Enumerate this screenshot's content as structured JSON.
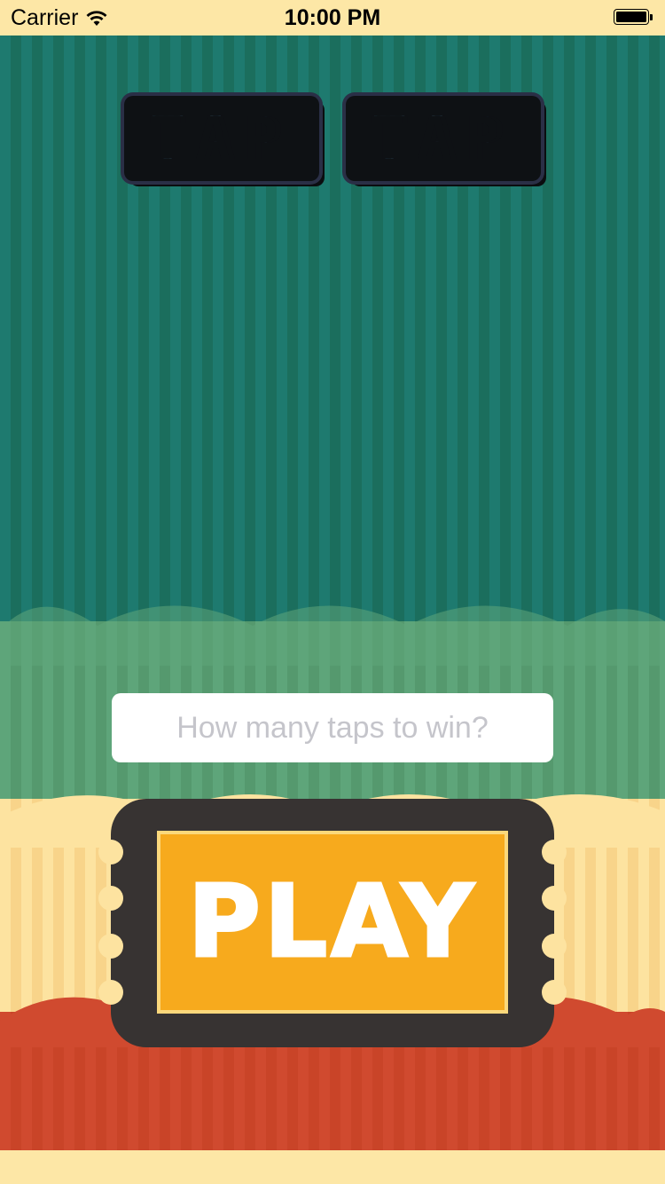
{
  "status_bar": {
    "carrier": "Carrier",
    "time": "10:00 PM",
    "wifi_icon": "wifi-icon",
    "battery_icon": "battery-icon",
    "battery_level": 1.0
  },
  "title": {
    "word1": "TAP",
    "word2": "TAP"
  },
  "taps_input": {
    "value": "",
    "placeholder": "How many taps to win?"
  },
  "play_button": {
    "label": "PLAY"
  },
  "colors": {
    "teal": "#1e7a6f",
    "green": "#5ea57a",
    "cream": "#fde3a0",
    "red": "#d04a2f",
    "ticket_dark": "#373332",
    "ticket_orange": "#f7aa1d",
    "title_blue": "#4f8fc0"
  }
}
